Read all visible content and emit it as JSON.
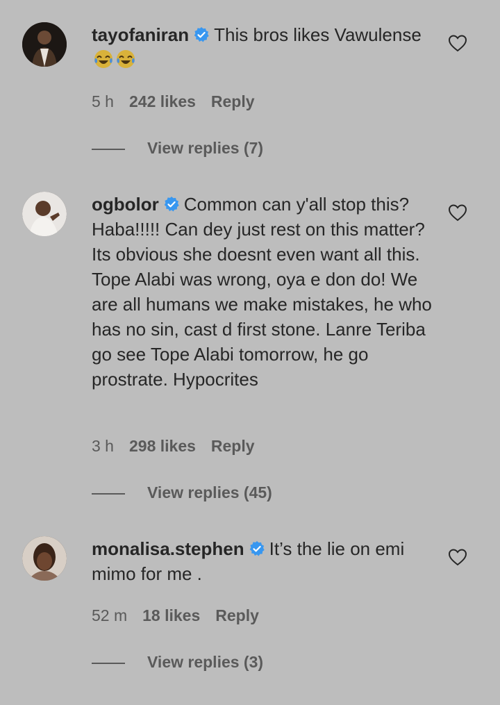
{
  "comments": [
    {
      "username": "tayofaniran",
      "text": "This bros likes Vawulense ",
      "emoji": [
        "tears-of-joy-emoji",
        "tears-of-joy-emoji"
      ],
      "time": "5 h",
      "likes": "242 likes",
      "reply_label": "Reply",
      "view_replies": "View replies (7)"
    },
    {
      "username": "ogbolor",
      "text": "Common can y'all stop this? Haba!!!!! Can dey just rest on this matter? Its obvious she doesnt even want all this. Tope Alabi was wrong, oya e don do! We are all humans we make mistakes, he who has no sin, cast d first stone. Lanre Teriba go see Tope Alabi tomorrow, he go prostrate. Hypocrites",
      "time": "3 h",
      "likes": "298 likes",
      "reply_label": "Reply",
      "view_replies": "View replies (45)"
    },
    {
      "username": "monalisa.stephen",
      "text": "It’s the lie on emi mimo for me .",
      "time": "52 m",
      "likes": "18 likes",
      "reply_label": "Reply",
      "view_replies": "View replies (3)"
    }
  ],
  "colors": {
    "background": "#bdbdbd",
    "text": "#262626",
    "muted": "#5a5a5a",
    "verified": "#3897f0"
  },
  "icons": {
    "verified": "verified-badge-icon",
    "like": "heart-outline-icon"
  }
}
